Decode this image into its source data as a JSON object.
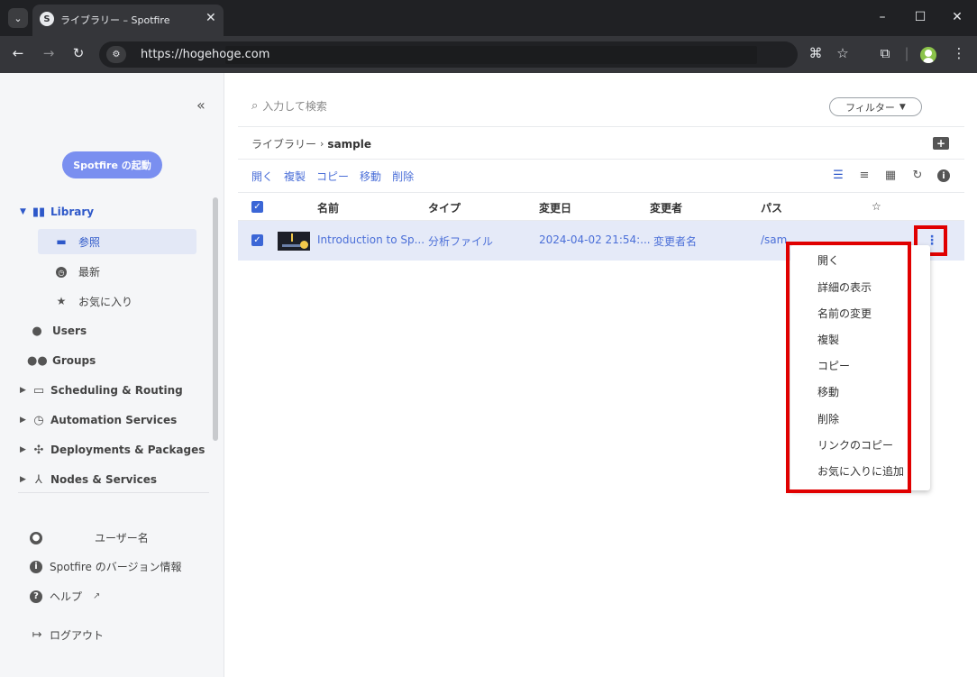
{
  "browser": {
    "tab_title": "ライブラリー – Spotfire",
    "url": "https://hogehoge.com"
  },
  "sidebar": {
    "collapse_glyph": "«",
    "launch_label": "Spotfire の起動",
    "library": {
      "label": "Library",
      "icon": "book-icon"
    },
    "library_children": [
      {
        "label": "参照",
        "icon": "folder-open-icon",
        "selected": true
      },
      {
        "label": "最新",
        "icon": "clock-icon",
        "selected": false
      },
      {
        "label": "お気に入り",
        "icon": "star-icon",
        "selected": false
      }
    ],
    "users": "Users",
    "groups": "Groups",
    "scheduling": "Scheduling & Routing",
    "automation": "Automation Services",
    "deployments": "Deployments & Packages",
    "nodes": "Nodes & Services",
    "user_name": "ユーザー名",
    "version_info": "Spotfire のバージョン情報",
    "help": "ヘルプ",
    "logout": "ログアウト"
  },
  "main": {
    "search_placeholder": "入力して検索",
    "filter_label": "フィルター",
    "breadcrumb": {
      "root": "ライブラリー",
      "current": "sample"
    },
    "actions": [
      "開く",
      "複製",
      "コピー",
      "移動",
      "削除"
    ],
    "columns": {
      "name": "名前",
      "type": "タイプ",
      "modified": "変更日",
      "modified_by": "変更者",
      "path": "パス",
      "favorite": "☆"
    },
    "rows": [
      {
        "name": "Introduction to Sp...",
        "type": "分析ファイル",
        "modified": "2024-04-02 21:54:...",
        "modified_by": "変更者名",
        "path": "/sam",
        "selected": true
      }
    ]
  },
  "context_menu": {
    "items": [
      "開く",
      "詳細の表示",
      "名前の変更",
      "複製",
      "コピー",
      "移動",
      "削除",
      "リンクのコピー",
      "お気に入りに追加"
    ]
  },
  "colors": {
    "accent": "#3b66d6",
    "launch_button": "#7a8ff0",
    "highlight_box": "#e00000",
    "selected_row": "#e5eaf8"
  }
}
